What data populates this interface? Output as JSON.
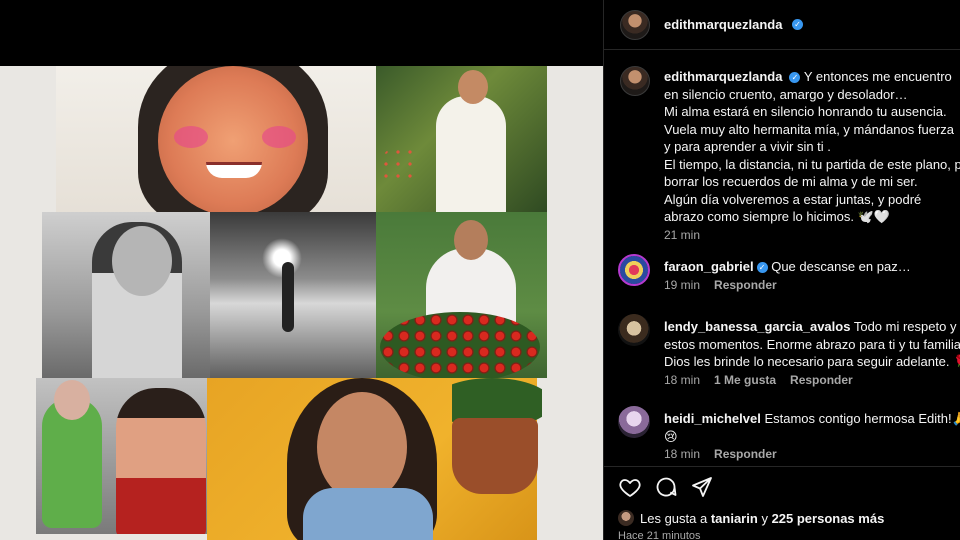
{
  "post": {
    "author": "edithmarquezlanda",
    "caption_user": "edithmarquezlanda",
    "caption_text": "Y entonces me encuentro en silencio cruento, amargo y desolador…\nMi alma estará en silencio honrando tu ausencia.\nVuela muy alto hermanita mía, y mándanos fuerza y para aprender a vivir sin ti .\nEl tiempo, la distancia, ni tu partida de este plano, p borrar los recuerdos de mi alma y de mi ser.\nAlgún día volveremos a estar juntas, y podré abrazo como siempre lo hicimos. 🕊️🤍",
    "caption_time": "21 min"
  },
  "comments": [
    {
      "user": "faraon_gabriel",
      "verified": true,
      "text": "Que descanse en paz…",
      "time": "19 min",
      "likes": "",
      "reply": "Responder"
    },
    {
      "user": "lendy_banessa_garcia_avalos",
      "verified": false,
      "text": "Todo mi respeto y c estos momentos. Enorme abrazo para ti y tu familia Dios les brinde lo necesario para seguir adelante. 🌹",
      "time": "18 min",
      "likes": "1 Me gusta",
      "reply": "Responder"
    },
    {
      "user": "heidi_michelvel",
      "verified": false,
      "text": "Estamos contigo hermosa Edith!🙏\n😢",
      "time": "18 min",
      "likes": "",
      "reply": "Responder"
    }
  ],
  "actions": {
    "like_icon": "heart-icon",
    "comment_icon": "comment-icon",
    "share_icon": "share-icon"
  },
  "likes_summary": {
    "prefix": "Les gusta a",
    "user": "taniarin",
    "connector": "y",
    "count": "225 personas más"
  },
  "posted_ago": "Hace 21 minutos",
  "colors": {
    "background": "#000000",
    "verified": "#3897f0",
    "muted_text": "#a8a8a8"
  }
}
